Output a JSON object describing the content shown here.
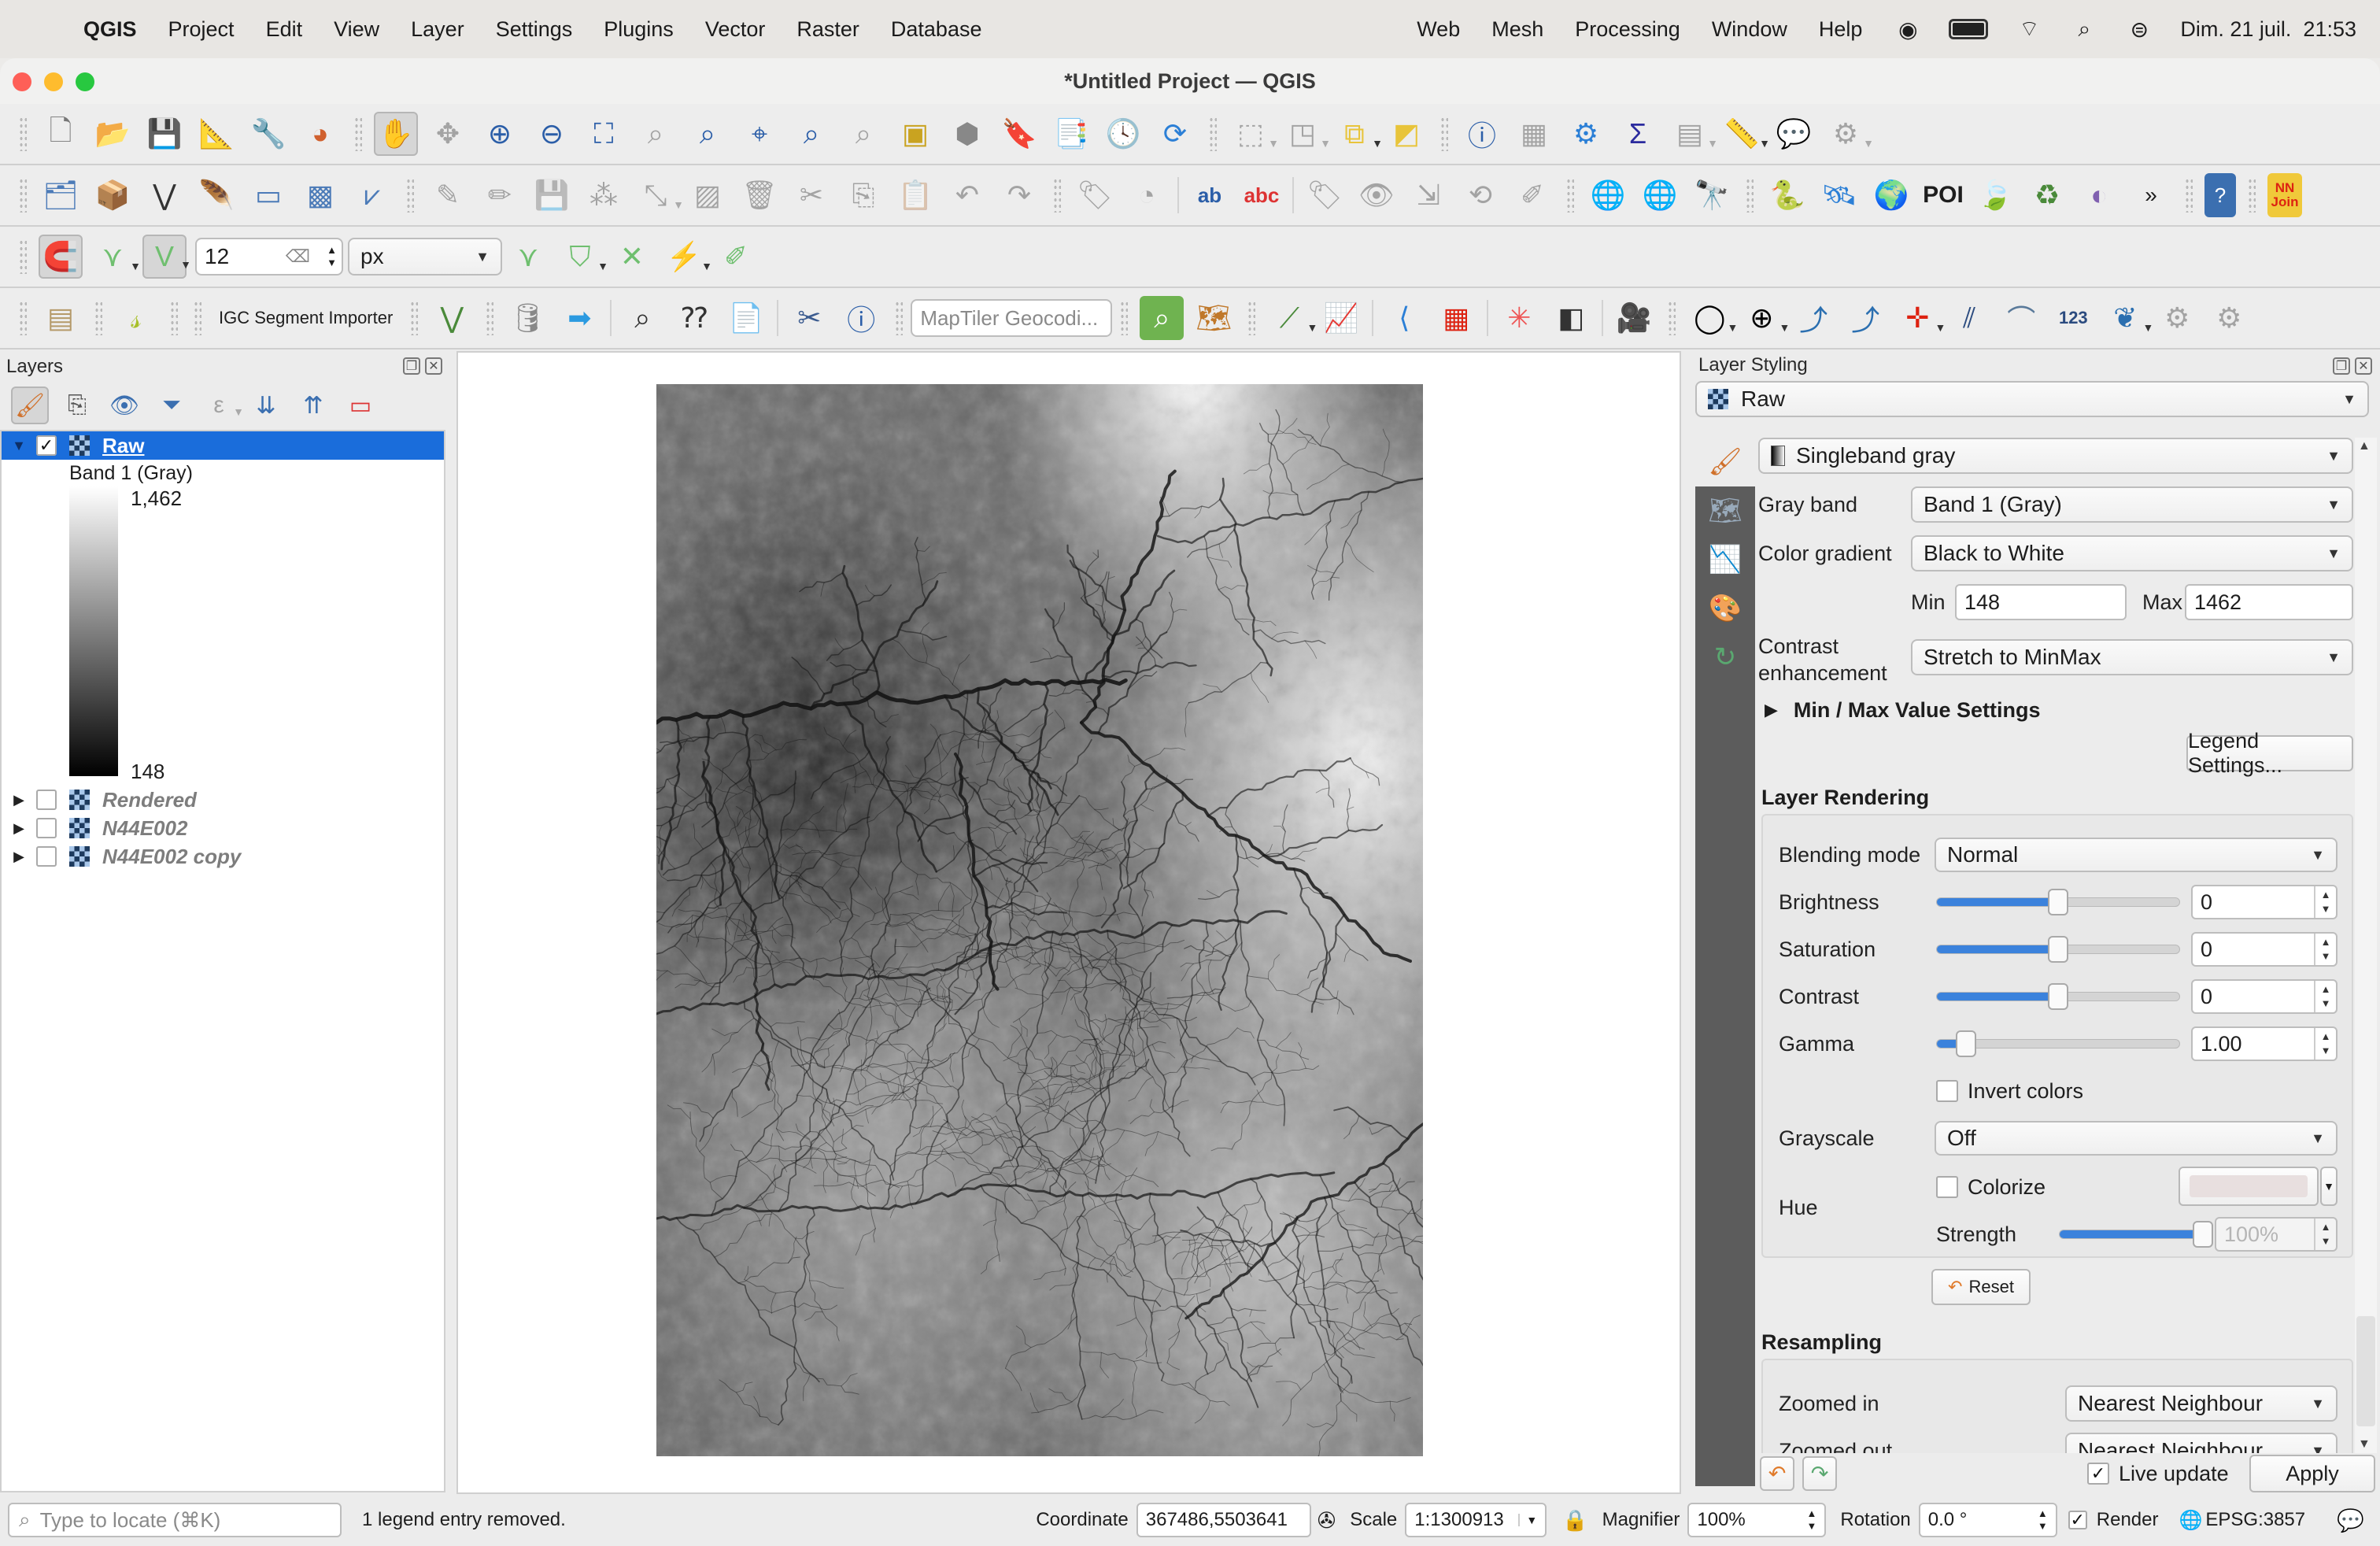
{
  "menubar": {
    "app_name": "QGIS",
    "items": [
      "Project",
      "Edit",
      "View",
      "Layer",
      "Settings",
      "Plugins",
      "Vector",
      "Raster",
      "Database"
    ],
    "right_items": [
      "Web",
      "Mesh",
      "Processing",
      "Window",
      "Help"
    ],
    "clock": "Dim. 21 juil.  21:53"
  },
  "window": {
    "title": "*Untitled Project — QGIS"
  },
  "toolbars": {
    "snapping_tolerance": "12",
    "snapping_units": "px",
    "igc_label": "IGC Segment Importer",
    "maptiler_placeholder": "MapTiler Geocodi...",
    "poi_label": "POI",
    "nnjoin_label": "NN Join",
    "overflow_label": "»"
  },
  "layers_panel": {
    "title": "Layers",
    "layers": [
      {
        "name": "Raw",
        "checked": true,
        "expanded": true,
        "selected": true
      },
      {
        "name": "Rendered",
        "checked": false,
        "expanded": false,
        "selected": false
      },
      {
        "name": "N44E002",
        "checked": false,
        "expanded": false,
        "selected": false
      },
      {
        "name": "N44E002 copy",
        "checked": false,
        "expanded": false,
        "selected": false
      }
    ],
    "legend": {
      "band": "Band 1 (Gray)",
      "max": "1,462",
      "min": "148"
    }
  },
  "styling_panel": {
    "title": "Layer Styling",
    "layer": "Raw",
    "renderer": "Singleband gray",
    "gray_band_label": "Gray band",
    "gray_band": "Band 1 (Gray)",
    "color_gradient_label": "Color gradient",
    "color_gradient": "Black to White",
    "min_label": "Min",
    "min": "148",
    "max_label": "Max",
    "max": "1462",
    "contrast_label_1": "Contrast",
    "contrast_label_2": "enhancement",
    "contrast_enhancement": "Stretch to MinMax",
    "minmax_settings": "Min / Max Value Settings",
    "legend_settings": "Legend Settings...",
    "layer_rendering_title": "Layer Rendering",
    "blending_mode_label": "Blending mode",
    "blending_mode": "Normal",
    "brightness_label": "Brightness",
    "brightness": "0",
    "brightness_slider": 0.5,
    "saturation_label": "Saturation",
    "saturation": "0",
    "saturation_slider": 0.5,
    "contrast_slider_label": "Contrast",
    "contrast": "0",
    "contrast_slider": 0.5,
    "gamma_label": "Gamma",
    "gamma": "1.00",
    "gamma_slider": 0.12,
    "invert_colors": "Invert colors",
    "invert_checked": false,
    "grayscale_label": "Grayscale",
    "grayscale": "Off",
    "hue_label": "Hue",
    "colorize": "Colorize",
    "colorize_checked": false,
    "colorize_color": "#e8dfdf",
    "strength_label": "Strength",
    "strength": "100%",
    "strength_slider": 1.0,
    "reset": "Reset",
    "resampling_title": "Resampling",
    "zoomed_in_label": "Zoomed in",
    "zoomed_in": "Nearest Neighbour",
    "zoomed_out_label": "Zoomed out",
    "zoomed_out": "Nearest Neighbour",
    "live_update": "Live update",
    "live_update_checked": true,
    "apply": "Apply"
  },
  "statusbar": {
    "locator_placeholder": "Type to locate (⌘K)",
    "message": "1 legend entry removed.",
    "coordinate_label": "Coordinate",
    "coordinate": "367486,5503641",
    "scale_label": "Scale",
    "scale": "1:1300913",
    "magnifier_label": "Magnifier",
    "magnifier": "100%",
    "rotation_label": "Rotation",
    "rotation": "0.0 °",
    "render_label": "Render",
    "render_checked": true,
    "crs": "EPSG:3857"
  },
  "colors": {
    "selection": "#1a6ddb",
    "slider_fill": "#3b82dc"
  }
}
